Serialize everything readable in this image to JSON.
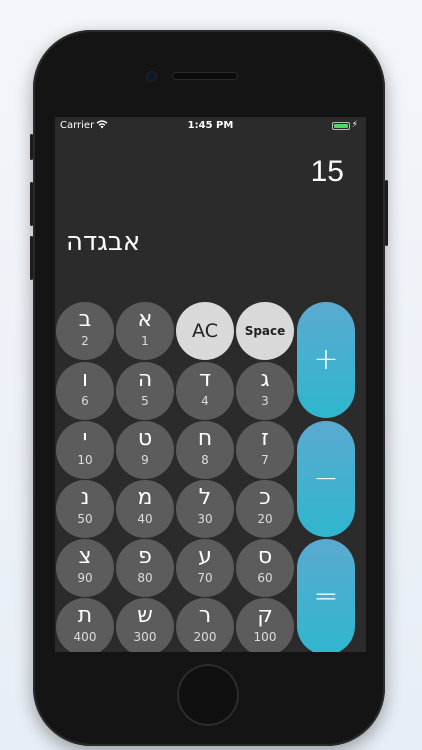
{
  "status": {
    "carrier": "Carrier",
    "time": "1:45 PM"
  },
  "display": {
    "value": "15",
    "word": "אבגדה"
  },
  "keys": [
    {
      "letter": "ב",
      "value": "2"
    },
    {
      "letter": "א",
      "value": "1"
    },
    {
      "letter": "ו",
      "value": "6"
    },
    {
      "letter": "ה",
      "value": "5"
    },
    {
      "letter": "ד",
      "value": "4"
    },
    {
      "letter": "ג",
      "value": "3"
    },
    {
      "letter": "י",
      "value": "10"
    },
    {
      "letter": "ט",
      "value": "9"
    },
    {
      "letter": "ח",
      "value": "8"
    },
    {
      "letter": "ז",
      "value": "7"
    },
    {
      "letter": "נ",
      "value": "50"
    },
    {
      "letter": "מ",
      "value": "40"
    },
    {
      "letter": "ל",
      "value": "30"
    },
    {
      "letter": "כ",
      "value": "20"
    },
    {
      "letter": "צ",
      "value": "90"
    },
    {
      "letter": "פ",
      "value": "80"
    },
    {
      "letter": "ע",
      "value": "70"
    },
    {
      "letter": "ס",
      "value": "60"
    },
    {
      "letter": "ת",
      "value": "400"
    },
    {
      "letter": "ש",
      "value": "300"
    },
    {
      "letter": "ר",
      "value": "200"
    },
    {
      "letter": "ק",
      "value": "100"
    }
  ],
  "controls": {
    "clear_label": "AC",
    "space_label": "Space"
  },
  "ops": {
    "plus": "+",
    "minus": "−",
    "equals": "="
  },
  "colors": {
    "background": "#2b2b2b",
    "key": "#5c5c5c",
    "light_key": "#d9d9d9",
    "operator": "#3bb3cf"
  }
}
